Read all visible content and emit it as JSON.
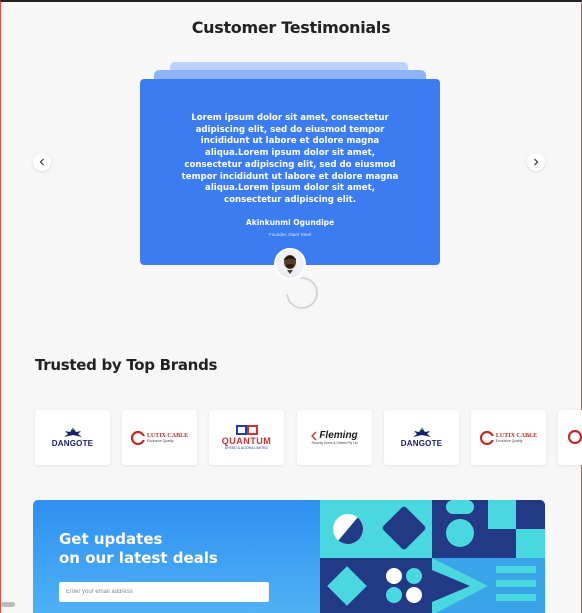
{
  "testimonials": {
    "title": "Customer Testimonials",
    "quote": "Lorem ipsum dolor sit amet, consectetur adipiscing elit, sed do eiusmod tempor incididunt ut labore et dolore magna aliqua.Lorem ipsum dolor sit amet, consectetur adipiscing elit, sed do eiusmod tempor incididunt ut labore et dolore magna aliqua.Lorem ipsum dolor sit amet, consectetur adipiscing elit.",
    "author_name": "Akinkunmi Ogundipe",
    "author_role": "Founder, Diper Steel",
    "prev_icon": "chevron-left-icon",
    "next_icon": "chevron-right-icon",
    "card_color": "#3b7cf0"
  },
  "brands": {
    "title": "Trusted by Top Brands",
    "items": [
      {
        "name": "DANGOTE",
        "icon": "dangote-logo"
      },
      {
        "name": "LUTIX CABLE",
        "sub": "Exclusive Quality",
        "icon": "lutix-logo"
      },
      {
        "name": "QUANTUM",
        "sub": "SPEED & AGORA LIMITED",
        "icon": "quantum-logo"
      },
      {
        "name": "Fleming",
        "sub": "Security Doors & Grimes Pty Ltd",
        "icon": "fleming-logo"
      },
      {
        "name": "DANGOTE",
        "icon": "dangote-logo"
      },
      {
        "name": "LUTIX CABLE",
        "sub": "Exclusive Quality",
        "icon": "lutix-logo"
      }
    ]
  },
  "newsletter": {
    "title_line1": "Get updates",
    "title_line2": "on our latest deals",
    "email_placeholder": "Enter your email address"
  }
}
